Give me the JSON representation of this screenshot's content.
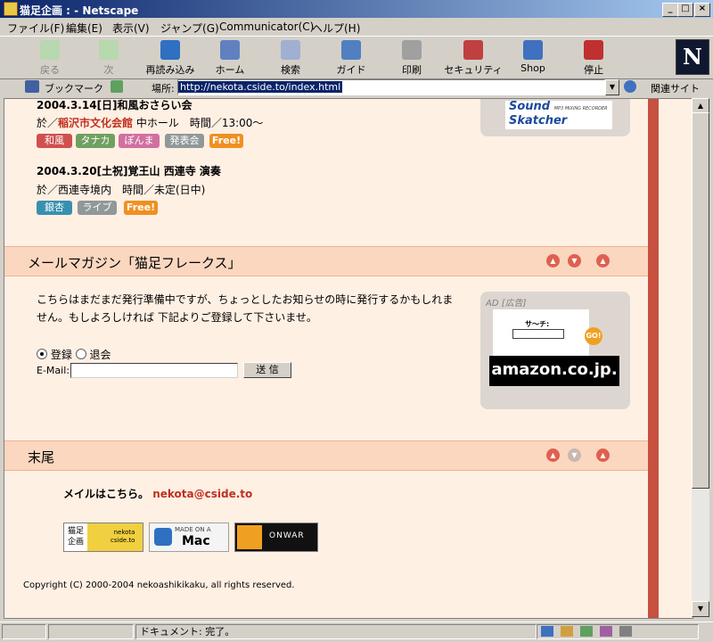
{
  "window": {
    "title": "猫足企画 : - Netscape"
  },
  "menu": [
    "ファイル(F)",
    "編集(E)",
    "表示(V)",
    "ジャンプ(G)",
    "Communicator(C)",
    "ヘルプ(H)"
  ],
  "toolbar": {
    "back": "戻る",
    "forward": "次",
    "reload": "再読み込み",
    "home": "ホーム",
    "search": "検索",
    "guide": "ガイド",
    "print": "印刷",
    "security": "セキュリティ",
    "shop": "Shop",
    "stop": "停止",
    "logo": "N"
  },
  "location": {
    "bookmarks": "ブックマーク",
    "label": "場所:",
    "url": "http://nekota.cside.to/index.html",
    "related": "関連サイト"
  },
  "events": [
    {
      "title": "2004.3.14[日]和風おさらい会",
      "venue_prefix": "於／",
      "venue_link": "稲沢市文化会館",
      "venue_rest": " 中ホール　時間／13:00〜",
      "tags": [
        "和風",
        "タナカ",
        "ぽんま",
        "発表会",
        "Free!"
      ]
    },
    {
      "title": "2004.3.20[土祝]覚王山 西連寺 演奏",
      "venue_text": "於／西連寺境内　時間／未定(日中)",
      "tags": [
        "銀杏",
        "ライブ",
        "Free!"
      ]
    }
  ],
  "ad_top": {
    "logo_line1": "Sound",
    "logo_line2": "Skatcher",
    "logo_sub": "MP3 MIXING RECORDER"
  },
  "mailmag": {
    "heading": "メールマガジン「猫足フレークス」",
    "desc": "こちらはまだまだ発行準備中ですが、ちょっとしたお知らせの時に発行するかもしれません。もしよろしければ 下記よりご登録して下さいませ。",
    "radio_subscribe": "登録",
    "radio_unsubscribe": "退会",
    "email_label": "E-Mail:",
    "email_value": "",
    "submit": "送 信"
  },
  "ad_amazon": {
    "label": "AD [広告]",
    "search_label": "サ～チ:",
    "go": "GO!",
    "brand": "amazon.co.jp."
  },
  "footer_section": {
    "heading": "末尾",
    "mail_text": "メイルはこちら。",
    "mail_link": "nekota@cside.to",
    "badge1_a": "猫足",
    "badge1_b": "企画",
    "badge1_c": "nekota",
    "badge1_d": "cside.to",
    "badge2_a": "MADE ON A",
    "badge2_b": "Mac",
    "badge3": "ONWAR",
    "copyright": "Copyright (C) 2000-2004 nekoashikikaku, all rights reserved."
  },
  "status": {
    "text": "ドキュメント: 完了。"
  },
  "colors": {
    "page_bg": "#fff0e4",
    "section_head": "#fbd7c0",
    "accent": "#c85040",
    "link": "#c03020"
  }
}
